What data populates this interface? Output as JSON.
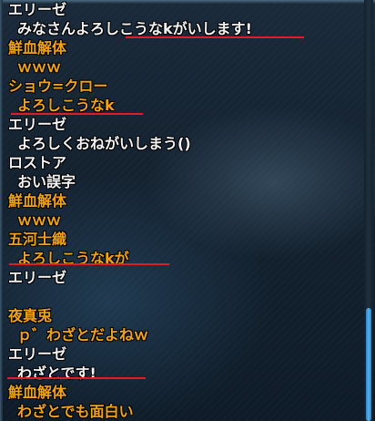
{
  "colors": {
    "name_white": "#f2f2f2",
    "name_orange": "#f0a21a",
    "underline_red": "#e01c28",
    "scroll_thumb": "#3a98dc"
  },
  "messages": [
    {
      "sender": "エリーゼ",
      "text": "みなさんよろしこうなkがいします!",
      "color": "white"
    },
    {
      "sender": "鮮血解体",
      "text": "ｗｗｗ",
      "color": "orange"
    },
    {
      "sender": "ショウ=クロー",
      "text": "よろしこうなk",
      "color": "orange"
    },
    {
      "sender": "エリーゼ",
      "text": "よろしくおねがいしまう()",
      "color": "white"
    },
    {
      "sender": "ロストア",
      "text": "おい誤字",
      "color": "white"
    },
    {
      "sender": "鮮血解体",
      "text": "ｗｗｗ",
      "color": "orange"
    },
    {
      "sender": "五河士織",
      "text": "よろしこうなkが",
      "color": "orange"
    },
    {
      "sender": "エリーゼ",
      "text": "",
      "color": "white"
    },
    {
      "sender": "夜真兎",
      "text": "ｐ゛わざとだよねｗ",
      "color": "orange"
    },
    {
      "sender": "エリーゼ",
      "text": "わざとです!",
      "color": "white"
    },
    {
      "sender": "鮮血解体",
      "text": "わざとでも面白い",
      "color": "orange"
    }
  ]
}
